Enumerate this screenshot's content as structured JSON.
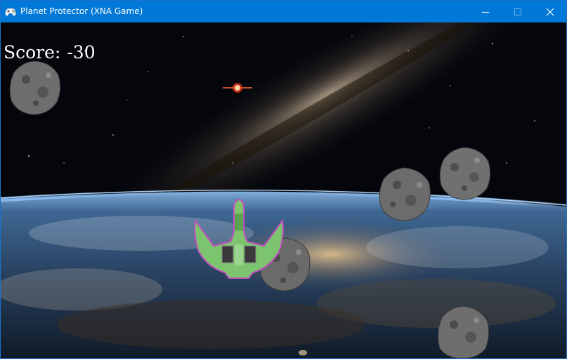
{
  "window": {
    "title": "Planet Protector (XNA Game)",
    "title_bar_color": "#0078d7",
    "icon": "gamepad-icon",
    "controls": [
      "minimize-icon",
      "maximize-icon",
      "close-icon"
    ]
  },
  "game": {
    "score_label": "Score:",
    "score_value": "-30",
    "player_ship": "green-starship",
    "enemy_projectile": "red-laser-shot",
    "asteroid_count": 6,
    "background": "earth-from-orbit-with-milky-way"
  }
}
